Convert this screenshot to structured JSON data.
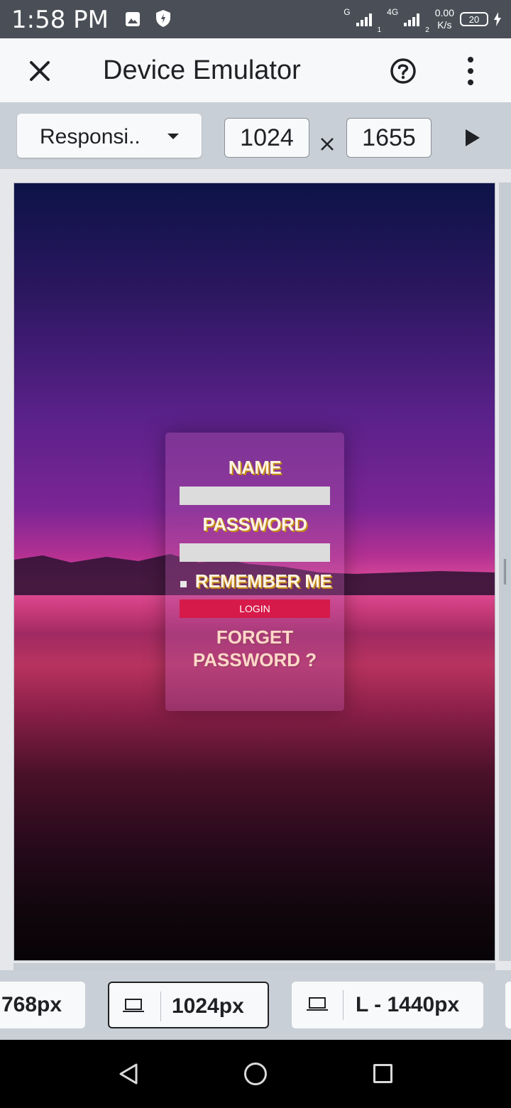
{
  "status_bar": {
    "time": "1:58 PM",
    "network_label": "G",
    "network_4g": "4G",
    "sim1": "1",
    "sim2": "2",
    "speed_value": "0.00",
    "speed_unit": "K/s",
    "battery": "20",
    "icons": [
      "image-icon",
      "shield-icon",
      "signal-icon",
      "battery-icon",
      "charging-icon"
    ]
  },
  "app_bar": {
    "title": "Device Emulator",
    "icons": [
      "close-icon",
      "help-icon",
      "more-vert-icon"
    ]
  },
  "toolbar": {
    "device_select": "Responsi..",
    "width": "1024",
    "height": "1655",
    "icons": [
      "dropdown-caret-icon",
      "times-icon",
      "play-icon"
    ]
  },
  "login_card": {
    "name_label": "NAME",
    "password_label": "PASSWORD",
    "remember_label": "REMEMBER ME",
    "login_button": "LOGIN",
    "forget_line1": "FORGET",
    "forget_line2": "PASSWORD ?"
  },
  "device_chips": [
    {
      "label": "768px",
      "selected": false
    },
    {
      "label": "1024px",
      "selected": true
    },
    {
      "label": "L - 1440px",
      "selected": false
    }
  ],
  "nav_bar": {
    "icons": [
      "back-icon",
      "home-icon",
      "recents-icon"
    ]
  },
  "colors": {
    "status_bar": "#4a4f57",
    "app_bar": "#f6f8fa",
    "toolbar": "#c9cfd6",
    "login_button": "#d61a4a"
  }
}
